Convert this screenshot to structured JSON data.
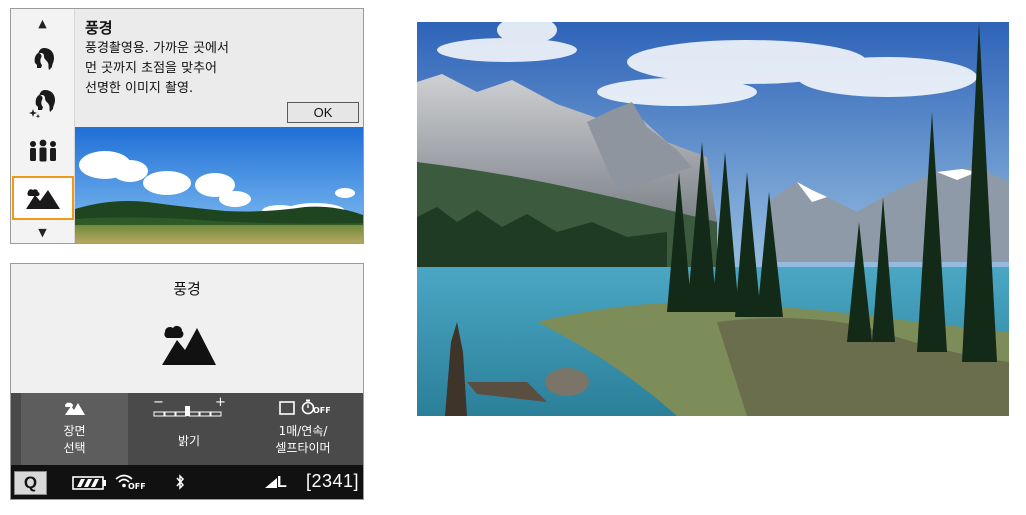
{
  "scene_menu": {
    "up_arrow": "▲",
    "down_arrow": "▼",
    "items": [
      {
        "icon": "portrait-icon",
        "selected": false
      },
      {
        "icon": "smooth-skin-icon",
        "selected": false
      },
      {
        "icon": "group-photo-icon",
        "selected": false
      },
      {
        "icon": "landscape-icon",
        "selected": true
      }
    ],
    "title": "풍경",
    "description_lines": [
      "풍경촬영용. 가까운 곳에서",
      "먼 곳까지 초점을 맞추어",
      "선명한 이미지 촬영."
    ],
    "ok_label": "OK"
  },
  "lcd": {
    "mode_title": "풍경",
    "settings": [
      {
        "label_lines": [
          "장면",
          "선택"
        ],
        "icon": "landscape-icon"
      },
      {
        "label_lines": [
          "밝기"
        ],
        "icon": "brightness-scale-icon",
        "scale_left": "−",
        "scale_right": "+"
      },
      {
        "label_lines": [
          "1매/연속/",
          "셀프타이머"
        ],
        "icon": "drive-mode-icon",
        "timer_text": "OFF"
      }
    ],
    "status": {
      "q_label": "Q",
      "wifi_text": "OFF",
      "quality": "L",
      "shots_remaining": "[2341]"
    }
  },
  "colors": {
    "selection_border": "#ef9a1a",
    "settings_bar": "#4a4a4a",
    "status_bar": "#111111"
  }
}
